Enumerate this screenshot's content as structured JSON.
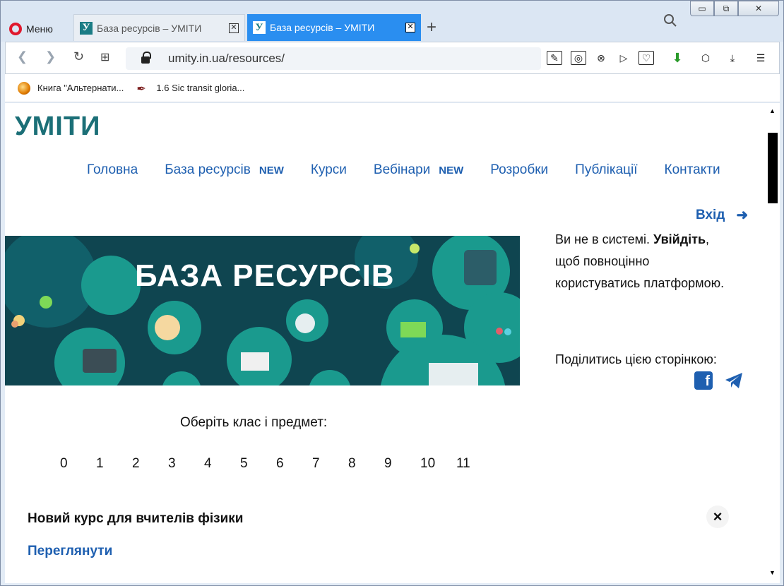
{
  "browser": {
    "menu_label": "Меню",
    "tabs": [
      {
        "favicon": "У",
        "title": "База ресурсів – УМІТИ",
        "active": false
      },
      {
        "favicon": "У",
        "title": "База ресурсів – УМІТИ",
        "active": true
      }
    ],
    "new_tab": "+",
    "url": "umity.in.ua/resources/",
    "window_buttons": {
      "minimize": "▭",
      "maximize": "⧉",
      "close": "✕"
    },
    "bookmarks": [
      {
        "label": "Книга \"Альтернати...",
        "icon": "orange-ball-icon"
      },
      {
        "label": "1.6 Sic transit gloria...",
        "icon": "feather-icon"
      }
    ]
  },
  "site": {
    "logo": "УМІТИ",
    "nav": [
      {
        "label": "Головна",
        "badge": ""
      },
      {
        "label": "База ресурсів",
        "badge": "NEW"
      },
      {
        "label": "Курси",
        "badge": ""
      },
      {
        "label": "Вебінари",
        "badge": "NEW"
      },
      {
        "label": "Розробки",
        "badge": ""
      },
      {
        "label": "Публікації",
        "badge": ""
      },
      {
        "label": "Контакти",
        "badge": ""
      }
    ],
    "login_label": "Вхід",
    "banner_title": "БАЗА РЕСУРСІВ",
    "sidebar": {
      "line1_prefix": "Ви не в системі. ",
      "line1_link": "Увійдіть",
      "line1_suffix": ",",
      "line2": "щоб повноцінно",
      "line3": "користуватись платформою.",
      "share_label": "Поділитись цією сторінкою:"
    },
    "choose_label": "Оберіть клас і предмет:",
    "classes": [
      "0",
      "1",
      "2",
      "3",
      "4",
      "5",
      "6",
      "7",
      "8",
      "9",
      "10",
      "11"
    ],
    "promo": {
      "title": "Новий курс для вчителів фізики",
      "link": "Переглянути",
      "close": "×"
    }
  },
  "colors": {
    "brand": "#1b6f77",
    "link": "#1e5fb0",
    "active_tab": "#2a8ef0",
    "opera_red": "#e0182d"
  }
}
